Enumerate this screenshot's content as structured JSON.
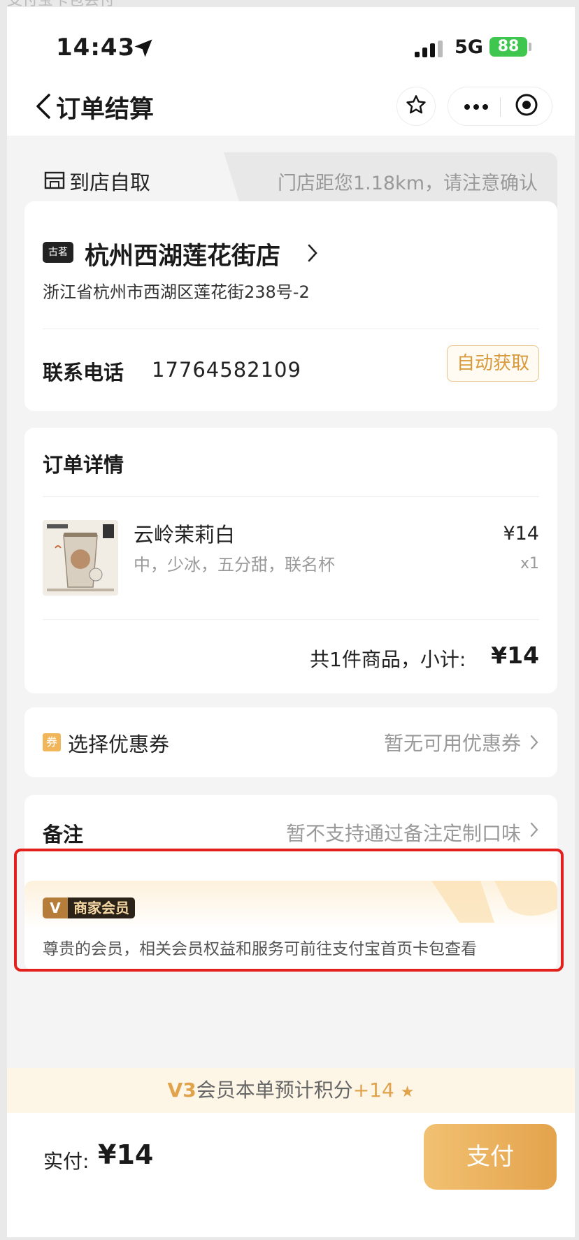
{
  "top_strip": "支付宝卡包会付",
  "status": {
    "time": "14:43",
    "network": "5G",
    "battery": "88"
  },
  "nav": {
    "title": "订单结算"
  },
  "pickup": {
    "label": "到店自取",
    "distance_note": "门店距您1.18km，请注意确认"
  },
  "store": {
    "brand": "古茗",
    "name": "杭州西湖莲花街店",
    "address": "浙江省杭州市西湖区莲花街238号-2",
    "phone_label": "联系电话",
    "phone": "17764582109",
    "auto_fill_label": "自动获取"
  },
  "order": {
    "title": "订单详情",
    "items": [
      {
        "name": "云岭茉莉白",
        "spec": "中，少冰，五分甜，联名杯",
        "price": "¥14",
        "qty": "x1"
      }
    ],
    "subtotal_text": "共1件商品，小计:",
    "subtotal_value": "¥14"
  },
  "coupon": {
    "icon_text": "券",
    "label": "选择优惠券",
    "value": "暂无可用优惠券"
  },
  "remark": {
    "label": "备注",
    "value": "暂不支持通过备注定制口味"
  },
  "member": {
    "badge_letter": "V",
    "badge_text": "商家会员",
    "note": "尊贵的会员，相关会员权益和服务可前往支付宝首页卡包查看"
  },
  "points": {
    "level": "V3",
    "text": "会员本单预计积分",
    "plus": "+14",
    "star": "★"
  },
  "footer": {
    "pay_label": "实付:",
    "pay_amount": "¥14",
    "pay_button": "支付"
  },
  "colors": {
    "accent": "#e0a24a",
    "highlight": "#e3201c",
    "battery": "#3ec64f"
  }
}
